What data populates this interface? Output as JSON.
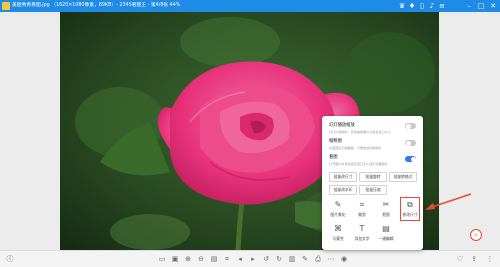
{
  "titlebar": {
    "title": "美图秀秀看图.jpg （1620×1080像素，89KB）- 2345看图王 - 第4/8张 44%"
  },
  "colors": {
    "titlebar": "#1e8be6",
    "accent": "#2e7de8",
    "highlight": "#e84a3a",
    "rose": "#e8327a"
  },
  "menu": {
    "toggles": [
      {
        "title": "幻灯播放缩放",
        "desc": "幻灯片放映时，自动缩放图片以适合窗口大小",
        "on": false
      },
      {
        "title": "缩略图",
        "desc": "在底部显示缩略图，方便快速切换图片",
        "on": false
      },
      {
        "title": "看图",
        "desc": "打开图片时自动适应窗口大小显示完整图片",
        "on": true
      }
    ],
    "batch_buttons_row1": [
      "批量改尺寸",
      "批量旋转",
      "批量转格式"
    ],
    "batch_buttons_row2": [
      "批量改水印",
      "批量压缩"
    ],
    "tools_row1": [
      "图片美化",
      "裁剪",
      "抠图",
      "修改尺寸"
    ],
    "tools_row2": [
      "马赛克",
      "添加文字",
      "一键编辑",
      ""
    ]
  },
  "icons": [
    "app-icon",
    "vip-icon",
    "gift-icon",
    "phone-icon",
    "mic-icon",
    "settings-icon",
    "minimize-icon",
    "maximize-icon",
    "close-icon",
    "info-icon",
    "zoom-in-icon",
    "zoom-out-icon",
    "prev-icon",
    "next-icon",
    "rotate-left-icon",
    "rotate-right-icon",
    "heart-icon",
    "share-icon",
    "more-icon"
  ]
}
